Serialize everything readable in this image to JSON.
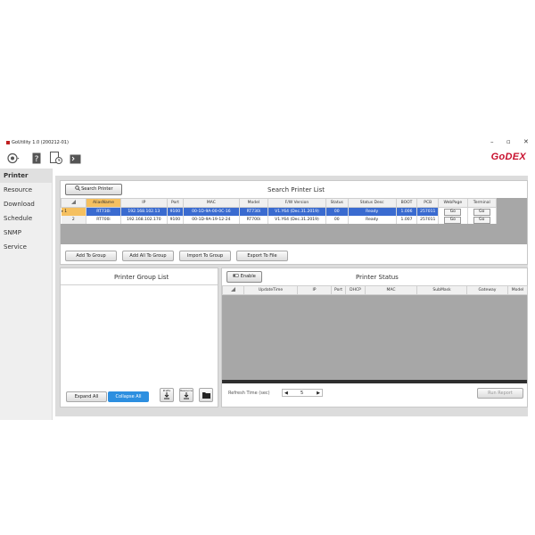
{
  "window": {
    "title": "GoUtility 1.0 (200212-01)",
    "controls": {
      "minimize": "–",
      "maximize": "▫",
      "close": "✕"
    },
    "brand": "GoDEX"
  },
  "toolbar": {
    "icons": [
      "printer-settings-icon",
      "help-icon",
      "clock-icon",
      "terminal-icon"
    ]
  },
  "sidebar": {
    "items": [
      {
        "label": "Printer"
      },
      {
        "label": "Resource"
      },
      {
        "label": "Download"
      },
      {
        "label": "Schedule"
      },
      {
        "label": "SNMP"
      },
      {
        "label": "Service"
      }
    ]
  },
  "search_panel": {
    "search_button": "Search Printer",
    "title": "Search Printer List",
    "columns": [
      "",
      "AliasName",
      "IP",
      "Port",
      "MAC",
      "Model",
      "F/W Version",
      "Status",
      "Status Desc",
      "BOOT",
      "PCB",
      "WebPage",
      "Terminal"
    ],
    "rows": [
      {
        "no": "1",
        "alias": "RT730i",
        "ip": "192.168.102.13",
        "port": "9100",
        "mac": "00-1D-9A-00-0C-16",
        "model": "RT730i",
        "fw": "V1.Y64 (Dec.31.2019)",
        "status": "00",
        "desc": "Ready",
        "boot": "1.006",
        "pcb": "257011",
        "webpage": "Go",
        "terminal": "Go"
      },
      {
        "no": "2",
        "alias": "RT700i",
        "ip": "192.168.102.170",
        "port": "9100",
        "mac": "00-1D-9A-19-12-24",
        "model": "RT700i",
        "fw": "V1.Y64 (Dec.31.2019)",
        "status": "00",
        "desc": "Ready",
        "boot": "1.007",
        "pcb": "257011",
        "webpage": "Go",
        "terminal": "Go"
      }
    ],
    "buttons": {
      "add_to_group": "Add To Group",
      "add_all_to_group": "Add All To Group",
      "import_to_group": "Import To Group",
      "export_to_file": "Export To File"
    }
  },
  "group_panel": {
    "title": "Printer Group List",
    "expand_all": "Expand All",
    "collapse_all": "Collapse All",
    "icon_buttons": [
      {
        "label": "Prefix",
        "icon": "download-icon"
      },
      {
        "label": "Resource",
        "icon": "download-icon"
      },
      {
        "label": "",
        "icon": "folder-icon"
      }
    ]
  },
  "status_panel": {
    "enable_button": "Enable",
    "title": "Printer Status",
    "columns": [
      "",
      "UpdateTime",
      "IP",
      "Port",
      "DHCP",
      "MAC",
      "SubMask",
      "Gateway",
      "Model"
    ],
    "refresh_label": "Refresh Time (sec)",
    "refresh_value": "5",
    "run_report": "Run Report"
  }
}
